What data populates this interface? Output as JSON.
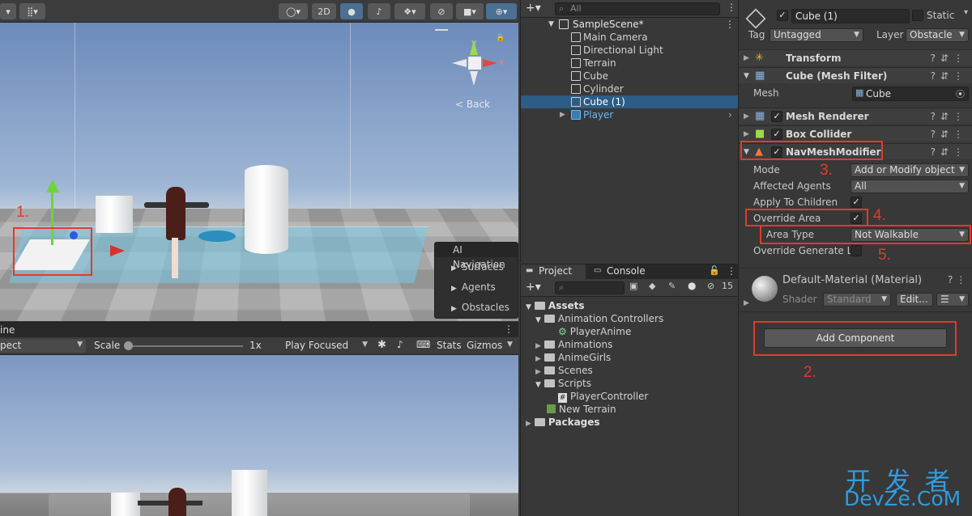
{
  "scene_toolbar": {
    "mode_2d": "2D"
  },
  "scene": {
    "gizmo_axis_y": "y",
    "gizmo_axis_x": "x",
    "back_label": "< Back",
    "ai_navigation": {
      "title": "AI Navigation",
      "items": [
        "Surfaces",
        "Agents",
        "Obstacles"
      ]
    },
    "annotation_1": "1."
  },
  "game": {
    "tab_label": "ine",
    "aspect_label": "pect",
    "scale_label": "Scale",
    "scale_value": "1x",
    "play_mode": "Play Focused",
    "stats_label": "Stats",
    "gizmos_label": "Gizmos"
  },
  "hierarchy": {
    "search_placeholder": "All",
    "scene_name": "SampleScene*",
    "items": [
      "Main Camera",
      "Directional Light",
      "Terrain",
      "Cube",
      "Cylinder",
      "Cube (1)",
      "Player"
    ]
  },
  "project": {
    "tab_project": "Project",
    "tab_console": "Console",
    "hidden_count": "15",
    "tree": {
      "assets": "Assets",
      "animation_controllers": "Animation Controllers",
      "player_anime": "PlayerAnime",
      "animations": "Animations",
      "anime_girls": "AnimeGirls",
      "scenes": "Scenes",
      "scripts": "Scripts",
      "player_controller": "PlayerController",
      "new_terrain": "New Terrain",
      "packages": "Packages"
    }
  },
  "inspector": {
    "object_name": "Cube (1)",
    "static_label": "Static",
    "tag_label": "Tag",
    "tag_value": "Untagged",
    "layer_label": "Layer",
    "layer_value": "Obstacle",
    "components": {
      "transform": "Transform",
      "mesh_filter": "Cube (Mesh Filter)",
      "mesh_label": "Mesh",
      "mesh_value": "Cube",
      "mesh_renderer": "Mesh Renderer",
      "box_collider": "Box Collider",
      "navmesh_modifier": "NavMeshModifier"
    },
    "navmesh": {
      "mode_label": "Mode",
      "mode_value": "Add or Modify object",
      "agents_label": "Affected Agents",
      "agents_value": "All",
      "apply_children_label": "Apply To Children",
      "override_area_label": "Override Area",
      "area_type_label": "Area Type",
      "area_type_value": "Not Walkable",
      "override_gen_label": "Override Generate Lir"
    },
    "material": {
      "name": "Default-Material (Material)",
      "shader_label": "Shader",
      "shader_value": "Standard",
      "edit_label": "Edit..."
    },
    "add_component": "Add Component",
    "annotations": {
      "a2": "2.",
      "a3": "3.",
      "a4": "4.",
      "a5": "5."
    }
  },
  "watermark": {
    "line1": "开 发 者",
    "line2": "DevZe.CoM"
  }
}
